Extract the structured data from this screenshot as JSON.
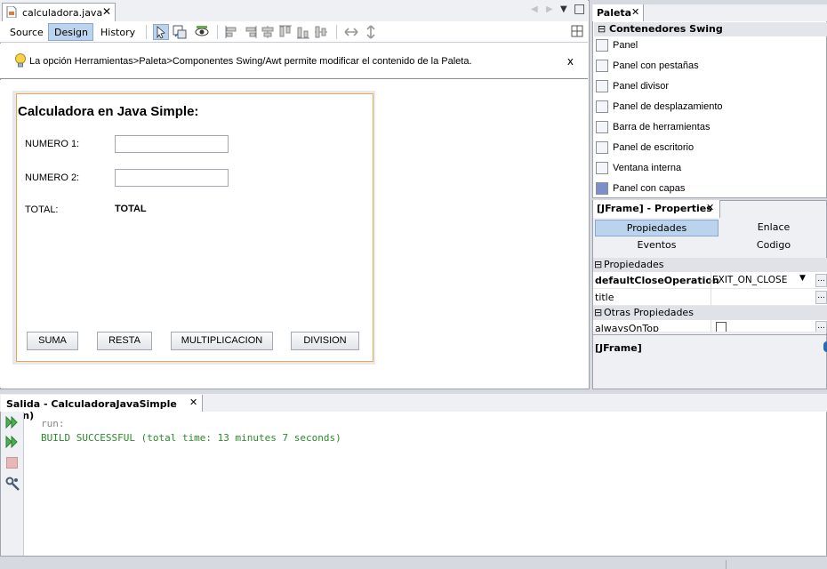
{
  "editor": {
    "file_tab": "calculadora.java",
    "close_glyph": "✕",
    "view_tabs": {
      "source": "Source",
      "design": "Design",
      "history": "History"
    },
    "hint": "La opción Herramientas>Paleta>Componentes Swing/Awt permite modificar el contenido de la Paleta.",
    "hint_close": "x"
  },
  "form": {
    "title": "Calculadora en Java Simple:",
    "numero1_label": "NUMERO 1:",
    "numero2_label": "NUMERO 2:",
    "total_label": "TOTAL:",
    "total_value": "TOTAL",
    "buttons": {
      "suma": "SUMA",
      "resta": "RESTA",
      "multiplicacion": "MULTIPLICACION",
      "division": "DIVISION"
    }
  },
  "palette": {
    "tab": "Paleta",
    "category": "Contenedores Swing",
    "items": [
      "Panel",
      "Panel con pestañas",
      "Panel divisor",
      "Panel de desplazamiento",
      "Barra de herramientas",
      "Panel de escritorio",
      "Ventana interna",
      "Panel con capas"
    ]
  },
  "properties": {
    "tab": "[JFrame] - Properties",
    "tabs": {
      "propiedades": "Propiedades",
      "enlace": "Enlace",
      "eventos": "Eventos",
      "codigo": "Codigo"
    },
    "section_propiedades": "Propiedades",
    "row_default_close_name": "defaultCloseOperation",
    "row_default_close_value": "EXIT_ON_CLOSE",
    "row_title_name": "title",
    "section_otras": "Otras Propiedades",
    "row_always_on_top_name": "alwaysOnTop",
    "dots": "...",
    "footer": "[JFrame]"
  },
  "output": {
    "tab": "Salida - CalculadoraJavaSimple (run)",
    "line1": "run:",
    "line2": "BUILD SUCCESSFUL (total time: 13 minutes 7 seconds)"
  },
  "colors": {
    "accent": "#bcd3ee",
    "frame_border": "#f2a545",
    "success_green": "#2a8a2a",
    "run_gray": "#888888"
  }
}
